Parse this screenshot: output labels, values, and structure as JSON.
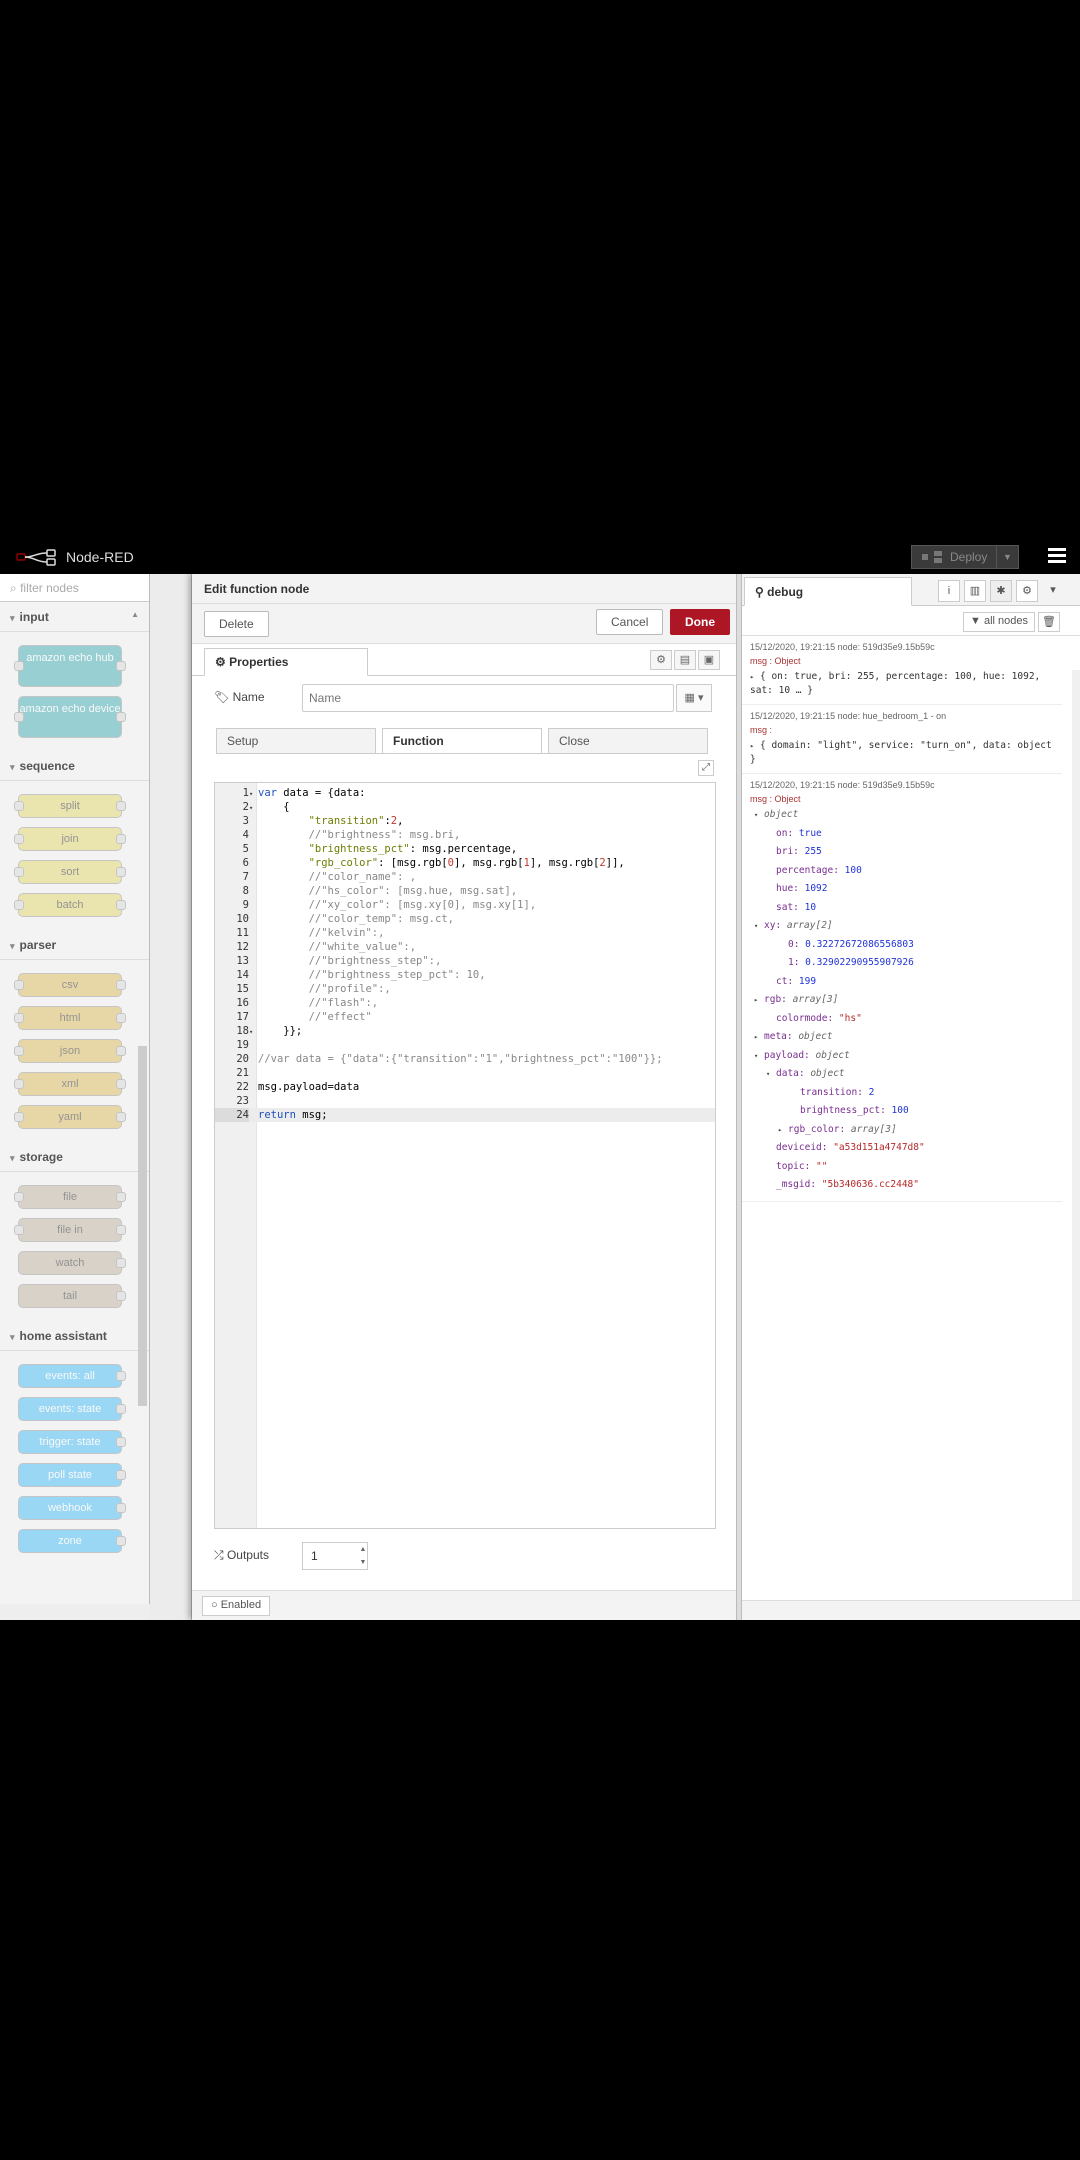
{
  "header": {
    "app_title": "Node-RED",
    "deploy_label": "Deploy"
  },
  "palette": {
    "filter_placeholder": "filter nodes",
    "categories": [
      {
        "name": "input",
        "nodes": [
          "amazon echo hub",
          "amazon echo device"
        ]
      },
      {
        "name": "sequence",
        "nodes": [
          "split",
          "join",
          "sort",
          "batch"
        ]
      },
      {
        "name": "parser",
        "nodes": [
          "csv",
          "html",
          "json",
          "xml",
          "yaml"
        ]
      },
      {
        "name": "storage",
        "nodes": [
          "file",
          "file in",
          "watch",
          "tail"
        ]
      },
      {
        "name": "home assistant",
        "nodes": [
          "events: all",
          "events: state",
          "trigger: state",
          "poll state",
          "webhook",
          "zone"
        ]
      }
    ]
  },
  "tray": {
    "title": "Edit function node",
    "delete_label": "Delete",
    "cancel_label": "Cancel",
    "done_label": "Done",
    "properties_tab": "Properties",
    "name_label": "Name",
    "name_placeholder": "Name",
    "tabs": {
      "setup": "Setup",
      "function": "Function",
      "close": "Close"
    },
    "outputs_label": "Outputs",
    "outputs_value": "1",
    "enabled_label": "Enabled",
    "active_line": 24,
    "code_lines": [
      {
        "n": "1",
        "fold": "▾",
        "code": "var data = {data:"
      },
      {
        "n": "2",
        "fold": "▾",
        "code": "    {"
      },
      {
        "n": "3",
        "fold": "",
        "code": "        \"transition\":2,"
      },
      {
        "n": "4",
        "fold": "",
        "code": "        //\"brightness\": msg.bri,"
      },
      {
        "n": "5",
        "fold": "",
        "code": "        \"brightness_pct\": msg.percentage,"
      },
      {
        "n": "6",
        "fold": "",
        "code": "        \"rgb_color\": [msg.rgb[0], msg.rgb[1], msg.rgb[2]],"
      },
      {
        "n": "7",
        "fold": "",
        "code": "        //\"color_name\": ,"
      },
      {
        "n": "8",
        "fold": "",
        "code": "        //\"hs_color\": [msg.hue, msg.sat],"
      },
      {
        "n": "9",
        "fold": "",
        "code": "        //\"xy_color\": [msg.xy[0], msg.xy[1],"
      },
      {
        "n": "10",
        "fold": "",
        "code": "        //\"color_temp\": msg.ct,"
      },
      {
        "n": "11",
        "fold": "",
        "code": "        //\"kelvin\":,"
      },
      {
        "n": "12",
        "fold": "",
        "code": "        //\"white_value\":,"
      },
      {
        "n": "13",
        "fold": "",
        "code": "        //\"brightness_step\":,"
      },
      {
        "n": "14",
        "fold": "",
        "code": "        //\"brightness_step_pct\": 10,"
      },
      {
        "n": "15",
        "fold": "",
        "code": "        //\"profile\":,"
      },
      {
        "n": "16",
        "fold": "",
        "code": "        //\"flash\":,"
      },
      {
        "n": "17",
        "fold": "",
        "code": "        //\"effect\""
      },
      {
        "n": "18",
        "fold": "▾",
        "code": "    }};"
      },
      {
        "n": "19",
        "fold": "",
        "code": ""
      },
      {
        "n": "20",
        "fold": "",
        "code": "//var data = {\"data\":{\"transition\":\"1\",\"brightness_pct\":\"100\"}};"
      },
      {
        "n": "21",
        "fold": "",
        "code": ""
      },
      {
        "n": "22",
        "fold": "",
        "code": "msg.payload=data"
      },
      {
        "n": "23",
        "fold": "",
        "code": ""
      },
      {
        "n": "24",
        "fold": "",
        "code": "return msg;"
      }
    ]
  },
  "sidebar": {
    "tab_label": "debug",
    "all_nodes_label": "all nodes",
    "messages": [
      {
        "time": "15/12/2020, 19:21:15",
        "node": "node: 519d35e9.15b59c",
        "topic": "msg : Object",
        "summary": "{ on: true, bri: 255, percentage: 100, hue: 1092, sat: 10 … }"
      },
      {
        "time": "15/12/2020, 19:21:15",
        "node": "node: hue_bedroom_1 - on",
        "topic": "msg :",
        "summary": "{ domain: \"light\", service: \"turn_on\", data: object }"
      },
      {
        "time": "15/12/2020, 19:21:15",
        "node": "node: 519d35e9.15b59c",
        "topic": "msg : Object",
        "tree": [
          {
            "indent": 0,
            "caret": "▾",
            "key": "",
            "val": "object",
            "cls": "type"
          },
          {
            "indent": 1,
            "caret": "",
            "key": "on: ",
            "val": "true",
            "cls": "bool"
          },
          {
            "indent": 1,
            "caret": "",
            "key": "bri: ",
            "val": "255",
            "cls": "num"
          },
          {
            "indent": 1,
            "caret": "",
            "key": "percentage: ",
            "val": "100",
            "cls": "num"
          },
          {
            "indent": 1,
            "caret": "",
            "key": "hue: ",
            "val": "1092",
            "cls": "num"
          },
          {
            "indent": 1,
            "caret": "",
            "key": "sat: ",
            "val": "10",
            "cls": "num"
          },
          {
            "indent": 0,
            "caret": "▾",
            "key": "xy: ",
            "val": "array[2]",
            "cls": "type"
          },
          {
            "indent": 2,
            "caret": "",
            "key": "0: ",
            "val": "0.32272672086556803",
            "cls": "num"
          },
          {
            "indent": 2,
            "caret": "",
            "key": "1: ",
            "val": "0.32902290955907926",
            "cls": "num"
          },
          {
            "indent": 1,
            "caret": "",
            "key": "ct: ",
            "val": "199",
            "cls": "num"
          },
          {
            "indent": 0,
            "caret": "▸",
            "key": "rgb: ",
            "val": "array[3]",
            "cls": "type"
          },
          {
            "indent": 1,
            "caret": "",
            "key": "colormode: ",
            "val": "\"hs\"",
            "cls": "str"
          },
          {
            "indent": 0,
            "caret": "▸",
            "key": "meta: ",
            "val": "object",
            "cls": "type"
          },
          {
            "indent": 0,
            "caret": "▾",
            "key": "payload: ",
            "val": "object",
            "cls": "type"
          },
          {
            "indent": 1,
            "caret": "▾",
            "key": "data: ",
            "val": "object",
            "cls": "type"
          },
          {
            "indent": 3,
            "caret": "",
            "key": "transition: ",
            "val": "2",
            "cls": "num"
          },
          {
            "indent": 3,
            "caret": "",
            "key": "brightness_pct: ",
            "val": "100",
            "cls": "num"
          },
          {
            "indent": 2,
            "caret": "▸",
            "key": "rgb_color: ",
            "val": "array[3]",
            "cls": "type"
          },
          {
            "indent": 1,
            "caret": "",
            "key": "deviceid: ",
            "val": "\"a53d151a4747d8\"",
            "cls": "str"
          },
          {
            "indent": 1,
            "caret": "",
            "key": "topic: ",
            "val": "\"\"",
            "cls": "str"
          },
          {
            "indent": 1,
            "caret": "",
            "key": "_msgid: ",
            "val": "\"5b340636.cc2448\"",
            "cls": "str"
          }
        ]
      }
    ]
  }
}
